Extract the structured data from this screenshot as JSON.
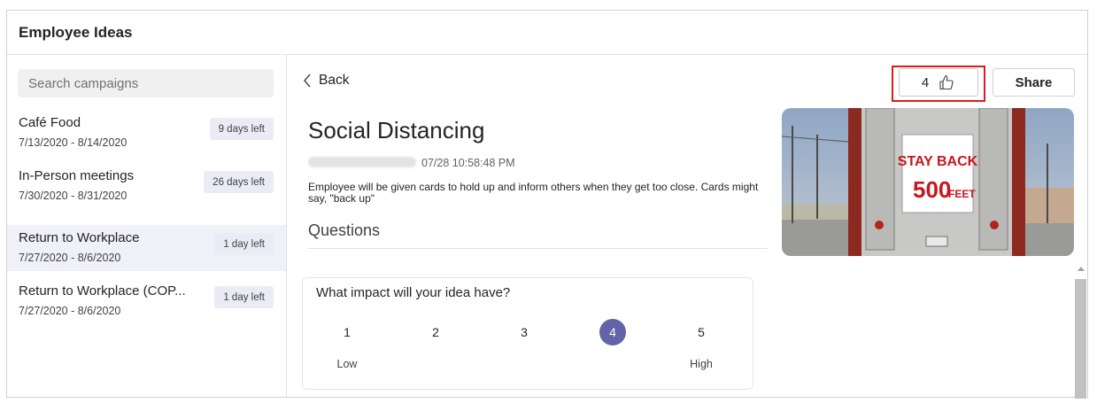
{
  "app": {
    "title": "Employee Ideas"
  },
  "sidebar": {
    "search_placeholder": "Search campaigns",
    "campaigns": [
      {
        "name": "Café Food",
        "dates": "7/13/2020 - 8/14/2020",
        "badge": "9 days left",
        "selected": false
      },
      {
        "name": "In-Person meetings",
        "dates": "7/30/2020 - 8/31/2020",
        "badge": "26 days left",
        "selected": false
      },
      {
        "name": "Return to Workplace",
        "dates": "7/27/2020 - 8/6/2020",
        "badge": "1 day left",
        "selected": true
      },
      {
        "name": "Return to Workplace (COP...",
        "dates": "7/27/2020 - 8/6/2020",
        "badge": "1 day left",
        "selected": false
      }
    ]
  },
  "main": {
    "back_label": "Back",
    "likes_count": "4",
    "share_label": "Share",
    "idea": {
      "title": "Social Distancing",
      "timestamp": "07/28 10:58:48 PM",
      "description": "Employee will be given cards to hold up and inform others when they get too close. Cards might say, \"back up\"",
      "image_text": {
        "line1": "STAY BACK",
        "line2a": "500",
        "line2b": "FEET"
      }
    },
    "questions_heading": "Questions",
    "question": {
      "text": "What impact will your idea have?",
      "options": [
        "1",
        "2",
        "3",
        "4",
        "5"
      ],
      "selected_value": 4,
      "low_label": "Low",
      "high_label": "High"
    }
  },
  "colors": {
    "accent": "#6264a7",
    "highlight": "#e0191b",
    "selected_row": "#f0f0f8"
  },
  "icons": {
    "back": "chevron-left-icon",
    "like": "thumbs-up-icon"
  }
}
